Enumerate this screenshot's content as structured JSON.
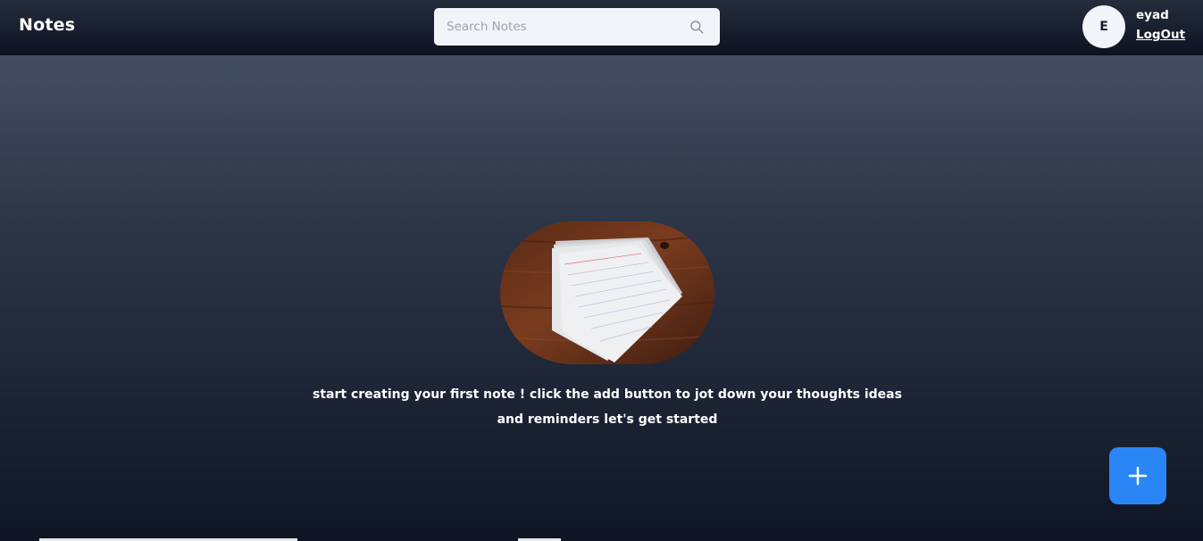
{
  "header": {
    "title": "Notes",
    "search": {
      "placeholder": "Search Notes",
      "value": "",
      "icon": "search-icon"
    },
    "user": {
      "avatar_initial": "E",
      "name": "eyad",
      "logout_label": "LogOut"
    }
  },
  "main": {
    "empty_state": {
      "image": "stack-of-index-cards-on-wooden-table",
      "message": "start creating your first note ! click the add button to jot down your thoughts ideas and reminders let's get started"
    }
  },
  "fab": {
    "icon": "plus-icon",
    "color": "#2b86f5"
  },
  "colors": {
    "navbar": "#0d1220",
    "accent": "#2b86f5",
    "search_bg": "#f1f4f8"
  }
}
